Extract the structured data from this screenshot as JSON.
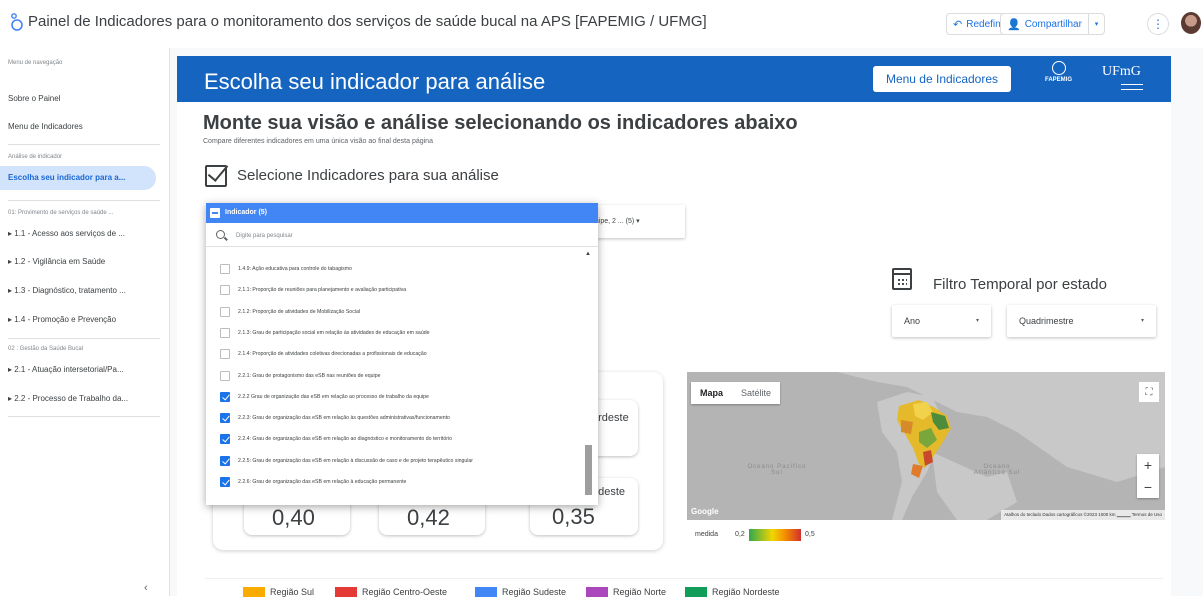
{
  "app": {
    "title": "Painel de Indicadores para o monitoramento dos serviços de saúde bucal na APS [FAPEMIG / UFMG]",
    "reset_label": "Redefinir",
    "share_label": "Compartilhar",
    "more_label": "⋮"
  },
  "sidebar": {
    "nav_header": "Menu de navegação",
    "about": "Sobre o Painel",
    "menu": "Menu de Indicadores",
    "analysis_header": "Análise de indicador",
    "active": "Escolha seu indicador para a...",
    "section1": "01: Provimento de serviços de saúde ...",
    "items1": [
      "▸ 1.1 - Acesso aos serviços de ...",
      "▸ 1.2 - Vigilância em Saúde",
      "▸ 1.3 - Diagnóstico, tratamento ...",
      "▸ 1.4 - Promoção e Prevenção"
    ],
    "section2": "02 : Gestão da Saúde Bucal",
    "items2": [
      "▸ 2.1 - Atuação intersetorial/Pa...",
      "▸ 2.2 - Processo de Trabalho da..."
    ],
    "collapse": "‹"
  },
  "banner": {
    "title": "Escolha seu indicador para análise",
    "menu_button": "Menu de Indicadores",
    "fapemig": "FAPEMIG",
    "ufmg": "UFmG"
  },
  "main": {
    "heading": "Monte sua visão e análise selecionando os indicadores abaixo",
    "subheading": "Compare diferentes indicadores em uma única visão ao final desta página",
    "select_label": "Selecione Indicadores para sua análise",
    "behind_dropdown": "quipe, 2 ... (5)  ▾",
    "filter_title": "Filtro Temporal por estado",
    "ano": "Ano",
    "quadrimestre": "Quadrimestre"
  },
  "dropdown": {
    "header": "Indicador (5)",
    "search_placeholder": "Digite para pesquisar",
    "items": [
      {
        "label": "1.4.9: Ação educativa para controle do tabagismo",
        "checked": false
      },
      {
        "label": "2.1.1: Proporção de reuniões para planejamento e avaliação participativa",
        "checked": false
      },
      {
        "label": "2.1.2: Proporção de atividades de Mobilização Social",
        "checked": false
      },
      {
        "label": "2.1.3: Grau de participação social em relação às atividades de educação em saúde",
        "checked": false
      },
      {
        "label": "2.1.4: Proporção de atividades coletivas direcionadas a profissionais de educação",
        "checked": false
      },
      {
        "label": "2.2.1: Grau de protagonismo das eSB nas reuniões de equipe",
        "checked": false
      },
      {
        "label": "2.2.2 Grau de organização das eSB em relação ao processo de trabalho da equipe",
        "checked": true
      },
      {
        "label": "2.2.3: Grau de organização das eSB em relação às questões administrativas/funcionamento",
        "checked": true
      },
      {
        "label": "2.2.4: Grau de organização das eSB em relação ao diagnóstico e monitoramento do território",
        "checked": true
      },
      {
        "label": "2.2.5: Grau de organização das eSB em relação à discussão de caso e de projeto terapêutico singular",
        "checked": true
      },
      {
        "label": "2.2.6: Grau de organização das eSB em relação à educação permanente",
        "checked": true
      }
    ]
  },
  "cards": {
    "nordeste": "ordeste",
    "sudeste": "udeste",
    "values": [
      "0,40",
      "0,42",
      "0,35"
    ]
  },
  "map": {
    "tab_map": "Mapa",
    "tab_sat": "Satélite",
    "ocean_pacific": "Oceano Pacífico Sul",
    "ocean_atlantic": "Oceano Atlântico Sul",
    "google": "Google",
    "attribution": "Atalhos do teclado  Dados cartográficos ©2023  1000 km ▁▁▁▁  Termos de Uso",
    "legend_label": "medida",
    "legend_min": "0,2",
    "legend_max": "0,5"
  },
  "regions": [
    {
      "label": "Região Sul",
      "color": "#f9ab00"
    },
    {
      "label": "Região Centro-Oeste",
      "color": "#e53935"
    },
    {
      "label": "Região Sudeste",
      "color": "#4285f4"
    },
    {
      "label": "Região Norte",
      "color": "#ab47bc"
    },
    {
      "label": "Região Nordeste",
      "color": "#0f9d58"
    }
  ]
}
